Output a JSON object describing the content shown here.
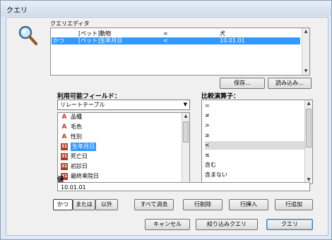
{
  "window": {
    "title": "クエリ"
  },
  "query_editor": {
    "label": "クエリエディタ",
    "rows": [
      {
        "conj": "",
        "field": "[ペット]動物",
        "op": "=",
        "value": "犬",
        "selected": false
      },
      {
        "conj": "かつ",
        "field": "[ペット]生年月日",
        "op": "<",
        "value": "10.01.01",
        "selected": true
      }
    ],
    "save_label": "保存...",
    "load_label": "読み込み..."
  },
  "fields": {
    "label": "利用可能フィールド：",
    "table_select": "リレートテーブル",
    "items": [
      {
        "icon": "text-icon",
        "label": "品種",
        "selected": false
      },
      {
        "icon": "text-icon",
        "label": "毛色",
        "selected": false
      },
      {
        "icon": "text-icon",
        "label": "性別",
        "selected": false
      },
      {
        "icon": "date-icon",
        "label": "生年月日",
        "selected": true
      },
      {
        "icon": "date-icon",
        "label": "死亡日",
        "selected": false
      },
      {
        "icon": "date-icon",
        "label": "初診日",
        "selected": false
      },
      {
        "icon": "date-icon",
        "label": "最終来院日",
        "selected": false
      }
    ]
  },
  "operators": {
    "label": "比較演算子：",
    "items": [
      {
        "label": "=",
        "selected": false
      },
      {
        "label": "≠",
        "selected": false
      },
      {
        "label": ">",
        "selected": false
      },
      {
        "label": "≥",
        "selected": false
      },
      {
        "label": "<",
        "selected": true
      },
      {
        "label": "≤",
        "selected": false
      },
      {
        "label": "含む",
        "selected": false
      },
      {
        "label": "含まない",
        "selected": false
      }
    ]
  },
  "value": {
    "label": "値",
    "text": "10.01.01"
  },
  "logic_buttons": {
    "and": "かつ",
    "or": "または",
    "not": "以外",
    "active": "and"
  },
  "action_buttons": {
    "clear_all": "すべて消去",
    "delete_row": "行削除",
    "insert_row": "行挿入",
    "add_row": "行追加"
  },
  "footer": {
    "cancel": "キャンセル",
    "narrow_query": "絞り込みクエリ",
    "query": "クエリ"
  },
  "colors": {
    "selection": "#3399ff",
    "text_icon": "#c0392b",
    "date_icon": "#b03a2e"
  }
}
